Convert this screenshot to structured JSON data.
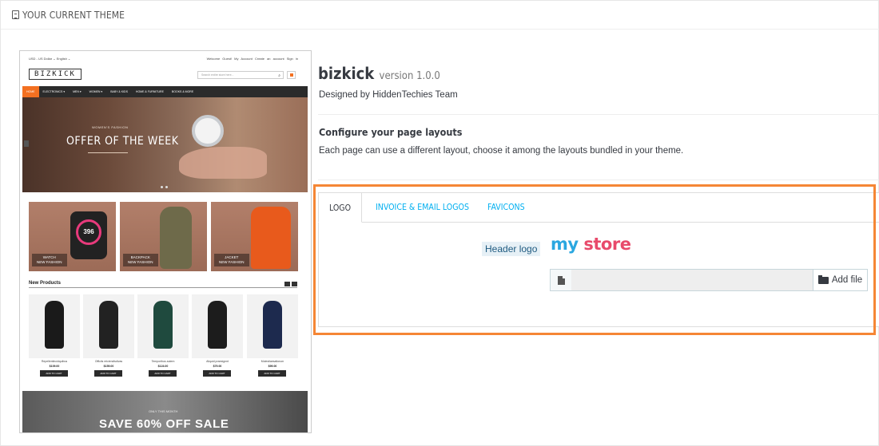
{
  "panel": {
    "heading": "YOUR CURRENT THEME"
  },
  "preview": {
    "topbar_left": "USD - US Dollar ⌄   English ⌄",
    "topbar_right": "Welcome Guest!  My Account  Create an account  Sign in",
    "logo": "BIZKICK",
    "search_placeholder": "Search entire store here...",
    "nav": [
      "HOME",
      "ELECTRONICS ▾",
      "MEN ▾",
      "WOMEN ▾",
      "BABY & KIDS",
      "HOME & FURNITURE",
      "BOOKS & MORE"
    ],
    "hero_sub": "WOMEN'S FASHION",
    "hero_title": "OFFER OF THE WEEK",
    "banners": [
      {
        "label": "WATCH",
        "sub": "NEW FASHION"
      },
      {
        "label": "BACKPACK",
        "sub": "NEW FASHION"
      },
      {
        "label": "JACKET",
        "sub": "NEW FASHION"
      }
    ],
    "watch_value": "396",
    "new_products": "New Products",
    "products": [
      {
        "name": "Repellentincidquibus",
        "price": "$109.00",
        "btn": "ADD TO CART"
      },
      {
        "name": "Officiis reiciendisdivas",
        "price": "$159.00",
        "btn": "ADD TO CART"
      },
      {
        "name": "Temporibus autem",
        "price": "$124.00",
        "btn": "ADD TO CART"
      },
      {
        "name": "Aliquid praesignnt",
        "price": "$79.00",
        "btn": "ADD TO CART"
      },
      {
        "name": "Molestiaesaltorum",
        "price": "$99.00",
        "btn": "ADD TO CART"
      }
    ],
    "bottom_small": "ONLY THIS MONTH",
    "bottom_sale": "SAVE 60% OFF SALE"
  },
  "theme": {
    "name": "bizkick",
    "version": "version 1.0.0",
    "designed_by": "Designed by HiddenTechies Team",
    "config_title": "Configure your page layouts",
    "config_desc": "Each page can use a different layout, choose it among the layouts bundled in your theme."
  },
  "tabs": [
    {
      "label": "LOGO",
      "active": true
    },
    {
      "label": "INVOICE & EMAIL LOGOS",
      "active": false
    },
    {
      "label": "FAVICONS",
      "active": false
    }
  ],
  "logo_tab": {
    "header_logo_label": "Header logo",
    "store_logo_word1": "my",
    "store_logo_word2": "store",
    "add_file": "Add file"
  },
  "colors": {
    "highlight": "#f58635",
    "accent": "#00aff0",
    "store_blue": "#2aa7e0",
    "store_pink": "#e84a6b"
  }
}
